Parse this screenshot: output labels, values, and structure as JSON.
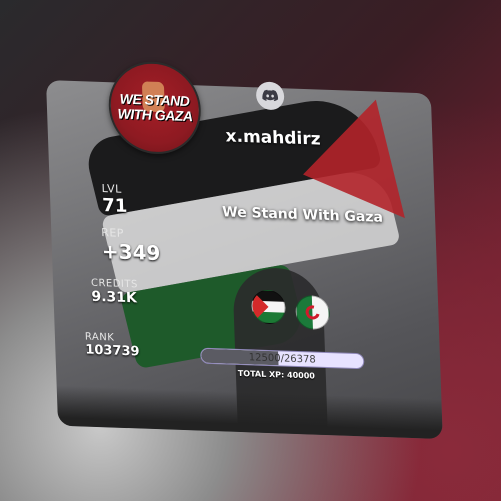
{
  "profile": {
    "username": "x.mahdirz",
    "avatar_text_line1": "WE STAND",
    "avatar_text_line2": "WITH GAZA",
    "status": "We Stand With Gaza",
    "discord_icon": "discord-icon"
  },
  "stats": {
    "lvl_label": "LVL",
    "lvl_value": "71",
    "rep_label": "REP",
    "rep_value": "+349",
    "credits_label": "CREDITS",
    "credits_value": "9.31K",
    "rank_label": "RANK",
    "rank_value": "103739"
  },
  "badges": [
    {
      "name": "palestine-flag-badge"
    },
    {
      "name": "algeria-flag-badge"
    }
  ],
  "xp": {
    "current": "12500",
    "separator": " / ",
    "next": "26378",
    "progress": 0.474,
    "total_label": "TOTAL XP: 40000"
  },
  "colors": {
    "xp_bar_bg": "#e7e2ff",
    "xp_fill": "#5b5b63",
    "avatar_red": "#a51e26"
  }
}
